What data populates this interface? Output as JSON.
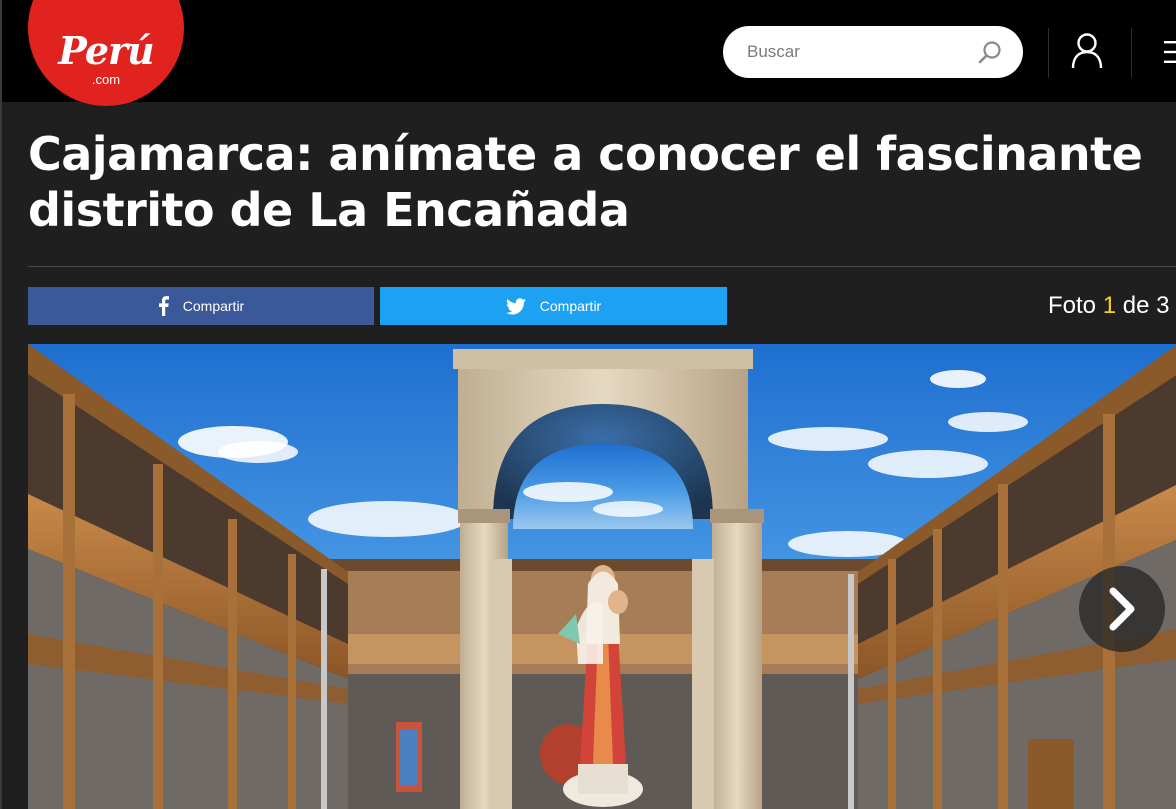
{
  "header": {
    "logo": {
      "word": "Perú",
      "sub": ".com"
    },
    "search": {
      "placeholder": "Buscar"
    },
    "icons": [
      "search-icon",
      "user-icon",
      "menu-icon"
    ]
  },
  "article": {
    "title": "Cajamarca: anímate a conocer el fascinante distrito de La Encañada"
  },
  "share": {
    "facebook_label": "Compartir",
    "twitter_label": "Compartir"
  },
  "gallery": {
    "prefix": "Foto",
    "current": "1",
    "separator": "de",
    "total": "3"
  },
  "colors": {
    "brand_red": "#e0231f",
    "facebook": "#3b5998",
    "twitter": "#1da1f2",
    "counter_highlight": "#f7d417",
    "background": "#1f1f1f",
    "header": "#000000"
  }
}
